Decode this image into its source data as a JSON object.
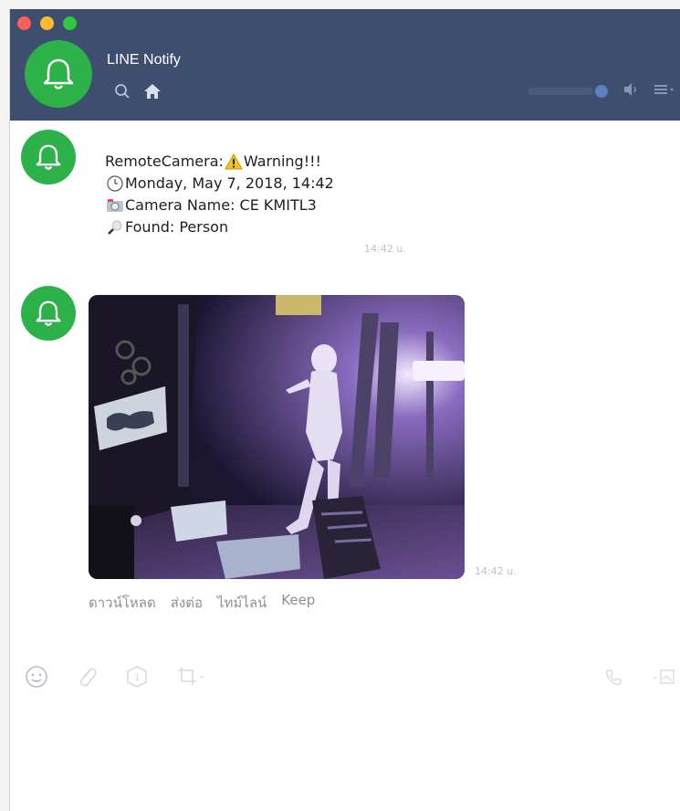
{
  "header": {
    "title": "LINE Notify",
    "icons": [
      "search-icon",
      "home-icon",
      "volume-icon",
      "menu-icon"
    ]
  },
  "messages": [
    {
      "sender_icon": "bell-icon",
      "lines": [
        {
          "icon": "",
          "text": "RemoteCamera: "
        },
        {
          "icon": "warning-icon",
          "text": "Warning!!!"
        },
        {
          "icon": "clock-icon",
          "text": "Monday, May 7, 2018, 14:42"
        },
        {
          "icon": "camera-icon",
          "text": "Camera Name: CE KMITL3"
        },
        {
          "icon": "magnifier-icon",
          "text": "Found: Person"
        }
      ],
      "time": "14:42 u."
    },
    {
      "sender_icon": "bell-icon",
      "type": "image",
      "time": "14:42 u.",
      "actions": [
        "ดาวน์โหลด",
        "ส่งต่อ",
        "ไทม์ไลน์",
        "Keep"
      ]
    }
  ],
  "toolbar": {
    "left_icons": [
      "emoji-icon",
      "attachment-icon",
      "sticker-icon",
      "screenshot-icon"
    ],
    "right_icons": [
      "call-icon",
      "image-icon"
    ]
  },
  "colors": {
    "header_bg": "#3e4e6e",
    "bot_green": "#2db24a",
    "time_gray": "#c2c2c2",
    "action_gray": "#8f8f8f"
  }
}
